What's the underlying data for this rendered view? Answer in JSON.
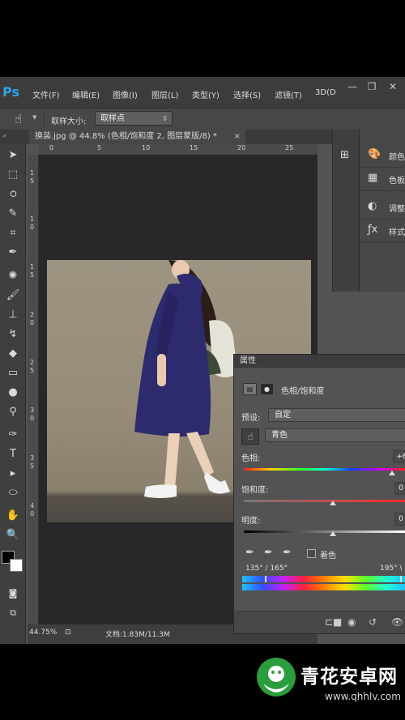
{
  "menubar": {
    "logo": "Ps",
    "items": [
      "文件(F)",
      "编辑(E)",
      "图像(I)",
      "图层(L)",
      "类型(Y)",
      "选择(S)",
      "滤镜(T)",
      "3D(D"
    ]
  },
  "options_bar": {
    "sample_size_label": "取样大小:",
    "sample_size_value": "取样点"
  },
  "document": {
    "tab_title": "换装.jpg @ 44.8% (色相/饱和度 2, 图层蒙版/8) *",
    "ruler_top": [
      "0",
      "5",
      "10",
      "15",
      "20",
      "25"
    ],
    "ruler_left": [
      "1",
      "5",
      "1",
      "0",
      "1",
      "5",
      "2",
      "0",
      "2",
      "5",
      "3",
      "0",
      "3",
      "5",
      "4",
      "0"
    ],
    "status_zoom": "44.75%",
    "status_doc": "文档:1.83M/11.3M"
  },
  "right_dock": {
    "panels": [
      {
        "icon": "palette-icon",
        "label": "颜色"
      },
      {
        "icon": "swatches-icon",
        "label": "色板"
      },
      {
        "icon": "adjustments-icon",
        "label": "调整"
      },
      {
        "icon": "styles-icon",
        "label": "样式"
      }
    ]
  },
  "properties": {
    "title": "属性",
    "adjustment_name": "色相/饱和度",
    "preset_label": "预设:",
    "preset_value": "自定",
    "channel_value": "青色",
    "hue_label": "色相:",
    "hue_value": "+6",
    "saturation_label": "饱和度:",
    "saturation_value": "0",
    "lightness_label": "明度:",
    "lightness_value": "0",
    "colorize_label": "着色",
    "range_left": "135° / 165°",
    "range_right": "195° \\"
  },
  "watermark": {
    "title": "青花安卓网",
    "url": "www.qhhlv.com"
  },
  "colors": {
    "app_bg": "#535353",
    "canvas_bg": "#282828",
    "dress": "#2e2a6e",
    "ps_blue": "#2fa3e7"
  }
}
